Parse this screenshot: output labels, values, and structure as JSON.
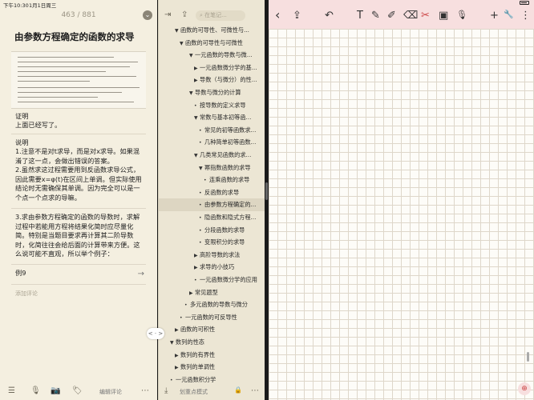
{
  "status": {
    "time": "下午10:30",
    "date": "1月1日周三",
    "battery": "●"
  },
  "reader": {
    "page_counter": "463 / 881",
    "chevron": "⌄",
    "title": "由参数方程确定的函数的求导",
    "proof_label": "证明",
    "proof_text": "上面已经写了。",
    "notes_label": "说明",
    "note_1": "1.注意不是对t求导，而是对x求导。如果混淆了这一点，会做出错误的答案。",
    "note_2": "2.虽然求这过程需要用到反函数求导公式，因此需要x=φ(t)在区间上单调。但实际使用结论时无需确保其单调。因为完全可以是一个点一个点求的导嘛。",
    "note_3": "3.求由参数方程确定的函数的导数时，求解过程中若能用方程将结果化简时应尽量化简。特别是当题目要求再计算其二阶导数时，化简往往会给后面的计算带来方便。这么说可能不直观，所以举个例子：",
    "example_label": "例9",
    "example_arrow": "→",
    "add_comment": "添加评论",
    "bottom_bar": {
      "list_icon": "☰",
      "mic_icon": "🎙",
      "camera_icon": "📷",
      "tag_icon": "🏷",
      "edit_comment": "编辑评论",
      "more_icon": "⋯"
    }
  },
  "outline": {
    "search_placeholder": "在笔记...",
    "collapse_icon": "⇥",
    "share_icon": "⇪",
    "search_icon": "⌕",
    "rows": [
      {
        "text": "函数的可导性、可微性与...",
        "caret": "▼"
      },
      {
        "text": "函数的可导性与可微性",
        "caret": "▼"
      },
      {
        "text": "一元函数的导数与微...",
        "caret": "▼"
      },
      {
        "text": "一元函数微分学的基...",
        "caret": "▶"
      },
      {
        "text": "导数（与微分）的性...",
        "caret": "▶"
      },
      {
        "text": "导数与微分的计算",
        "caret": "▼"
      },
      {
        "text": "按导数的定义求导",
        "caret": "•"
      },
      {
        "text": "常数与基本初等函...",
        "caret": "▼"
      },
      {
        "text": "常见的初等函数求...",
        "caret": "•"
      },
      {
        "text": "几种简单初等函数...",
        "caret": "•"
      },
      {
        "text": "几类常见函数的求...",
        "caret": "▼"
      },
      {
        "text": "幂指数函数的求导",
        "caret": "▼"
      },
      {
        "text": "连乘函数的求导",
        "caret": "•"
      },
      {
        "text": "反函数的求导",
        "caret": "•"
      },
      {
        "text": "由参数方程确定的...",
        "caret": "•"
      },
      {
        "text": "隐函数和隐式方程...",
        "caret": "•"
      },
      {
        "text": "分段函数的求导",
        "caret": "•"
      },
      {
        "text": "变限积分的求导",
        "caret": "•"
      },
      {
        "text": "高阶导数的求法",
        "caret": "▶"
      },
      {
        "text": "求导的小技巧",
        "caret": "▶"
      },
      {
        "text": "一元函数微分学的应用",
        "caret": "•"
      },
      {
        "text": "常见题型",
        "caret": "▶"
      },
      {
        "text": "多元函数的导数与微分",
        "caret": "•"
      },
      {
        "text": "一元函数的可反导性",
        "caret": "•"
      },
      {
        "text": "函数的可积性",
        "caret": "▶"
      },
      {
        "text": "数列的性态",
        "caret": "▼"
      },
      {
        "text": "数列的有界性",
        "caret": "▶"
      },
      {
        "text": "数列的单调性",
        "caret": "▶"
      },
      {
        "text": "一元函数积分学",
        "caret": "•"
      }
    ],
    "bottom_label": "划重点模式",
    "bottom_left_icon": "⤓",
    "bottom_lock_icon": "🔒",
    "bottom_more_icon": "⋯"
  },
  "split_handle": "< · >",
  "notes": {
    "back_icon": "‹",
    "share_icon": "⇪",
    "undo_icon": "↶",
    "text_icon": "T",
    "pen_icon": "✎",
    "highlighter_icon": "✐",
    "eraser_icon": "⌫",
    "lasso_icon": "✂",
    "image_icon": "▣",
    "mic_icon": "🎙",
    "add_icon": "+",
    "wrench_icon": "🔧",
    "more_icon": "⋮",
    "zoom_icon": "⊕"
  },
  "colors": {
    "accent": "#c44444",
    "reader_bg": "#f4efe0",
    "toolbar_bg": "#f7dfdf"
  }
}
